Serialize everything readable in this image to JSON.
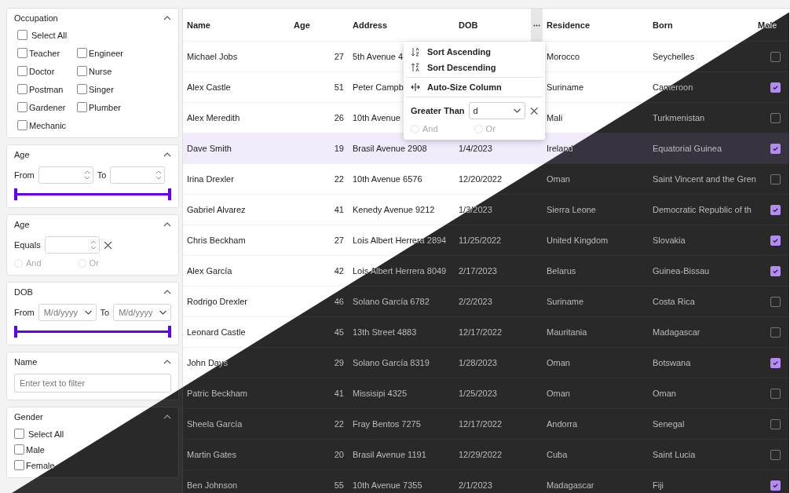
{
  "filter_panel": {
    "sections": [
      {
        "kind": "checklist-grid",
        "title": "Occupation",
        "expanded": true,
        "select_all": {
          "label": "Select All",
          "checked": false
        },
        "options": [
          {
            "label": "Teacher",
            "checked": false
          },
          {
            "label": "Engineer",
            "checked": false
          },
          {
            "label": "Doctor",
            "checked": false
          },
          {
            "label": "Nurse",
            "checked": false
          },
          {
            "label": "Postman",
            "checked": false
          },
          {
            "label": "Singer",
            "checked": false
          },
          {
            "label": "Gardener",
            "checked": false
          },
          {
            "label": "Plumber",
            "checked": false
          },
          {
            "label": "Mechanic",
            "checked": false
          }
        ]
      },
      {
        "kind": "number-range",
        "title": "Age",
        "expanded": true,
        "from_label": "From",
        "to_label": "To",
        "level": 1
      },
      {
        "kind": "equals",
        "title": "Age",
        "expanded": true,
        "label": "Equals",
        "operators": [
          {
            "label": "And",
            "selected": false
          },
          {
            "label": "Or",
            "selected": false
          }
        ]
      },
      {
        "kind": "date-range",
        "title": "DOB",
        "expanded": true,
        "from_label": "From",
        "from_placeholder": "M/d/yyyy",
        "to_label": "To",
        "to_placeholder": "M/d/yyyy",
        "level": 1
      },
      {
        "kind": "text",
        "title": "Name",
        "expanded": true,
        "placeholder": "Enter text to filter"
      },
      {
        "kind": "checklist",
        "title": "Gender",
        "expanded": true,
        "select_all": {
          "label": "Select All",
          "checked": false
        },
        "options": [
          {
            "label": "Male",
            "checked": false
          },
          {
            "label": "Female",
            "checked": false
          }
        ]
      }
    ]
  },
  "grid": {
    "columns": [
      "Name",
      "Age",
      "Address",
      "DOB",
      "Residence",
      "Born",
      "Male"
    ],
    "rows": [
      {
        "name": "Michael Jobs",
        "age": "27",
        "address": "5th Avenue 4",
        "residence": "Morocco",
        "born": "Seychelles",
        "male": false,
        "selected": false
      },
      {
        "name": "Alex Castle",
        "age": "51",
        "address": "Peter Campb",
        "residence": "Suriname",
        "born": "Cameroon",
        "male": true,
        "selected": false
      },
      {
        "name": "Alex Meredith",
        "age": "26",
        "address": "10th Avenue",
        "residence": "Mali",
        "born": "Turkmenistan",
        "male": false,
        "selected": false
      },
      {
        "name": "Dave Smith",
        "age": "19",
        "address": "Brasil Avenue 2908",
        "dob": "1/4/2023",
        "residence": "Ireland",
        "born": "Equatorial Guinea",
        "male": true,
        "selected": true
      },
      {
        "name": "Irina Drexler",
        "age": "22",
        "address": "10th Avenue 6576",
        "dob": "12/20/2022",
        "residence": "Oman",
        "born": "Saint Vincent and the Gren",
        "male": false,
        "selected": false
      },
      {
        "name": "Gabriel Alvarez",
        "age": "41",
        "address": "Kenedy Avenue 9212",
        "dob": "1/3/2023",
        "residence": "Sierra Leone",
        "born": "Democratic Republic of th",
        "male": true,
        "selected": false
      },
      {
        "name": "Chris Beckham",
        "age": "27",
        "address": "Lois Albert Herrera 2894",
        "dob": "11/25/2022",
        "residence": "United Kingdom",
        "born": "Slovakia",
        "male": true,
        "selected": false
      },
      {
        "name": "Alex García",
        "age": "42",
        "address": "Lois Albert Herrera 8049",
        "dob": "2/17/2023",
        "residence": "Belarus",
        "born": "Guinea-Bissau",
        "male": true,
        "selected": false
      },
      {
        "name": "Rodrigo Drexler",
        "age": "46",
        "address": "Solano García 6782",
        "dob": "2/2/2023",
        "residence": "Suriname",
        "born": "Costa Rica",
        "male": false,
        "selected": false
      },
      {
        "name": "Leonard Castle",
        "age": "45",
        "address": "13th Street 4883",
        "dob": "12/17/2022",
        "residence": "Mauritania",
        "born": "Madagascar",
        "male": false,
        "selected": false
      },
      {
        "name": "John Days",
        "age": "29",
        "address": "Solano García 8319",
        "dob": "1/28/2023",
        "residence": "Oman",
        "born": "Botswana",
        "male": true,
        "selected": false
      },
      {
        "name": "Patric Beckham",
        "age": "41",
        "address": "Missisipi 4325",
        "dob": "1/25/2023",
        "residence": "Oman",
        "born": "Oman",
        "male": false,
        "selected": false
      },
      {
        "name": "Sheela García",
        "age": "22",
        "address": "Fray Bentos 7275",
        "dob": "12/17/2022",
        "residence": "Andorra",
        "born": "Senegal",
        "male": false,
        "selected": false
      },
      {
        "name": "Martin Gates",
        "age": "20",
        "address": "Brasil Avenue 1191",
        "dob": "12/29/2022",
        "residence": "Cuba",
        "born": "Saint Lucia",
        "male": false,
        "selected": false
      },
      {
        "name": "Ben Johnson",
        "age": "55",
        "address": "10th Avenue 7355",
        "dob": "2/1/2023",
        "residence": "Madagascar",
        "born": "Fiji",
        "male": true,
        "selected": false
      }
    ],
    "column_menu": {
      "open": true,
      "items": [
        {
          "kind": "sort-ascending",
          "label": "Sort Ascending"
        },
        {
          "kind": "sort-descending",
          "label": "Sort Descending"
        },
        {
          "kind": "auto-size",
          "label": "Auto-Size Column"
        }
      ],
      "condition": {
        "label": "Greater Than",
        "value": "d"
      },
      "operators": [
        {
          "label": "And",
          "selected": false
        },
        {
          "label": "Or",
          "selected": false
        }
      ]
    }
  }
}
